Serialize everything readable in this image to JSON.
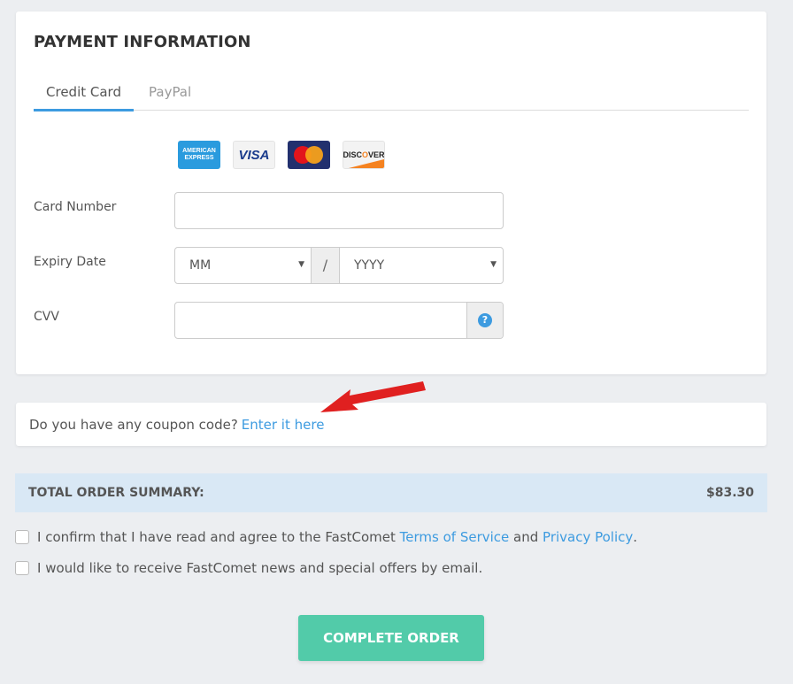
{
  "payment": {
    "title": "PAYMENT INFORMATION",
    "tabs": [
      {
        "label": "Credit Card",
        "active": true
      },
      {
        "label": "PayPal",
        "active": false
      }
    ],
    "card_brands": [
      {
        "name": "American Express",
        "text_line1": "AMERICAN",
        "text_line2": "EXPRESS"
      },
      {
        "name": "Visa",
        "text": "VISA"
      },
      {
        "name": "Mastercard"
      },
      {
        "name": "Discover",
        "text_pre": "DISC",
        "text_dot": "O",
        "text_post": "VER"
      }
    ],
    "fields": {
      "card_number": {
        "label": "Card Number",
        "value": ""
      },
      "expiry": {
        "label": "Expiry Date",
        "month": "MM",
        "separator": "/",
        "year": "YYYY"
      },
      "cvv": {
        "label": "CVV",
        "value": "",
        "help_icon": "?"
      }
    }
  },
  "coupon": {
    "question": "Do you have any coupon code?",
    "link": "Enter it here"
  },
  "summary": {
    "label": "TOTAL ORDER SUMMARY:",
    "total": "$83.30"
  },
  "agreements": {
    "tos_prefix": "I confirm that I have read and agree to the FastComet ",
    "tos_link": "Terms of Service",
    "tos_and": " and ",
    "privacy_link": "Privacy Policy",
    "tos_suffix": ".",
    "newsletter": "I would like to receive FastComet news and special offers by email."
  },
  "actions": {
    "complete_order": "COMPLETE ORDER"
  },
  "colors": {
    "accent": "#3d9be0",
    "button": "#52cba9",
    "summary_bg": "#d9e8f5",
    "arrow": "#e02020"
  }
}
